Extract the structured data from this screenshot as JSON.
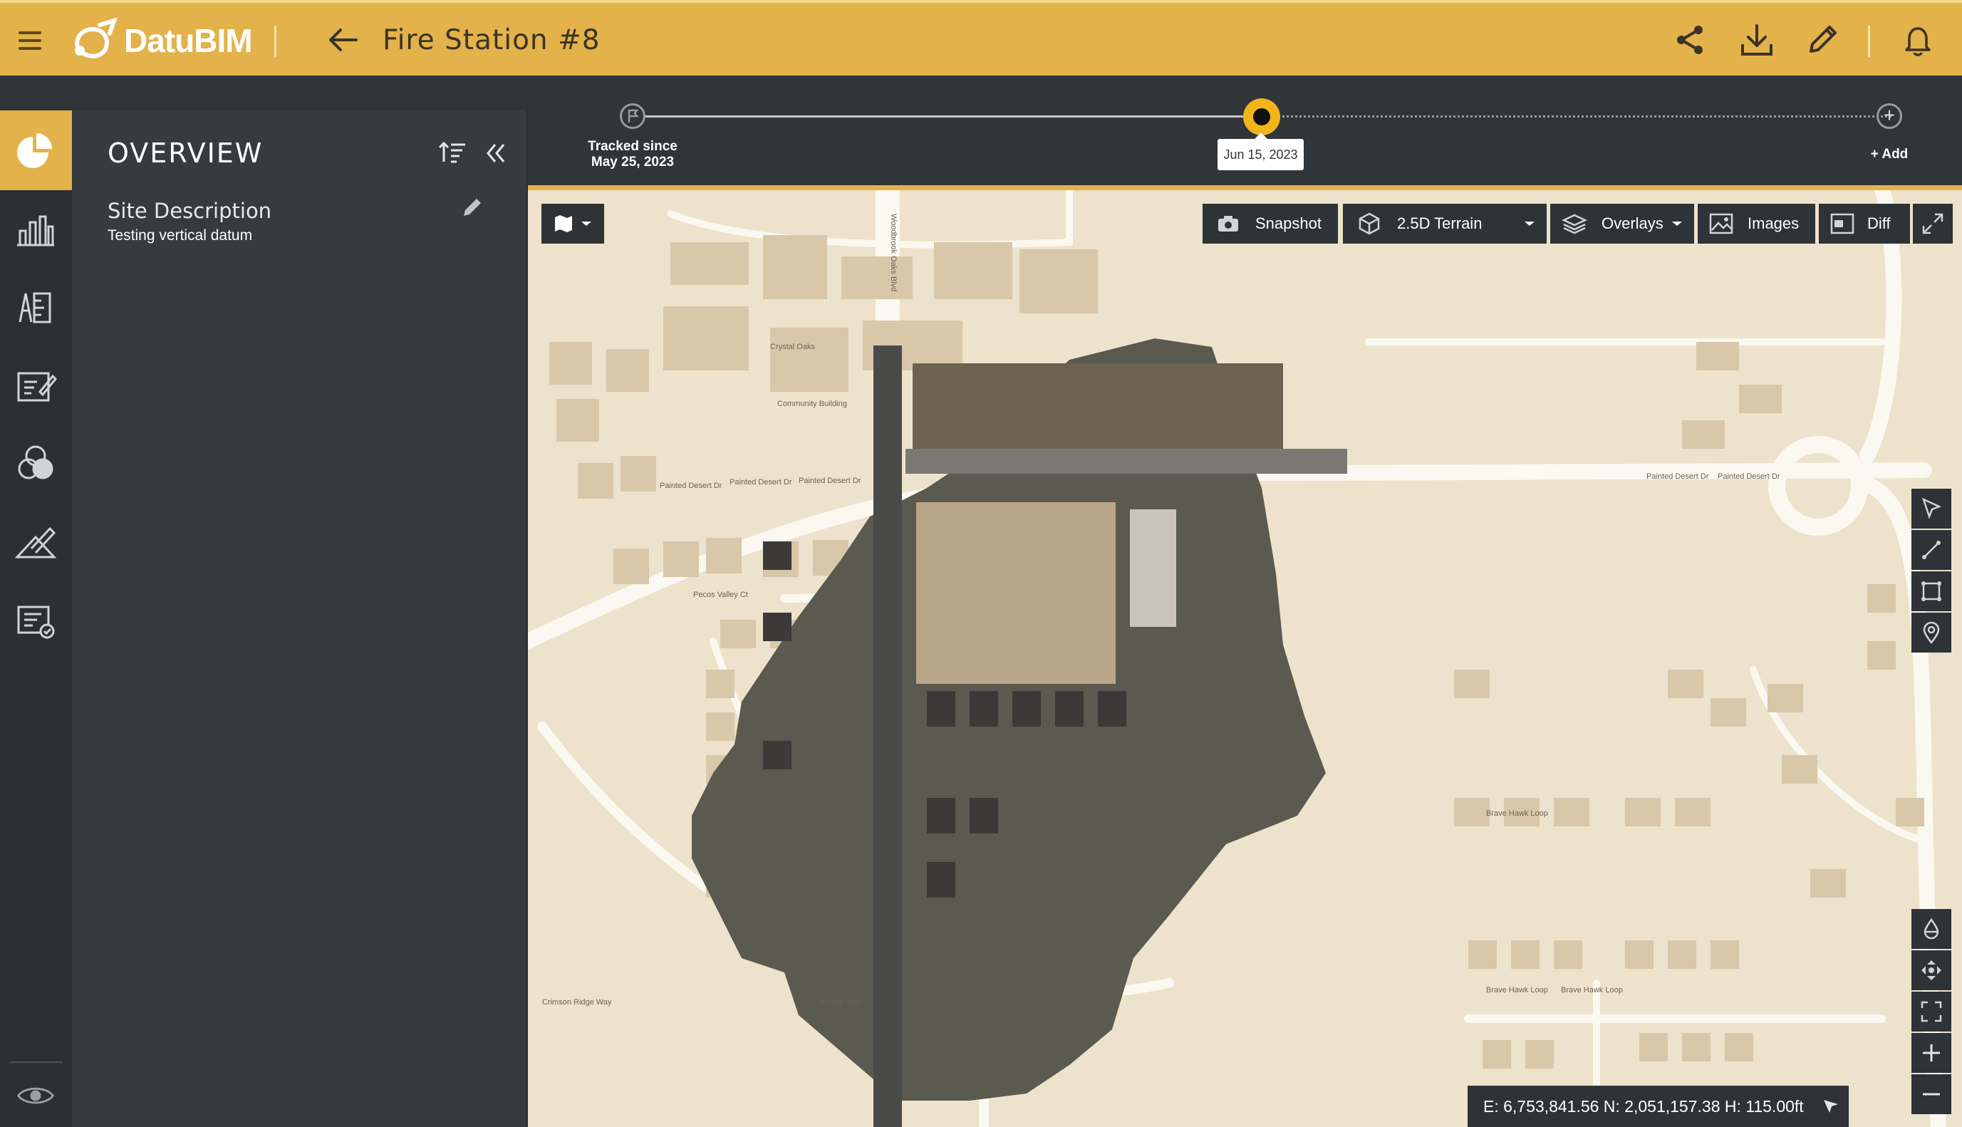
{
  "app": {
    "brand": "DatuBIM",
    "project_title": "Fire Station #8"
  },
  "topbar": {
    "icons": [
      "menu-icon",
      "back-arrow-icon",
      "share-icon",
      "download-icon",
      "edit-icon",
      "bell-icon"
    ]
  },
  "timeline": {
    "start_label_line1": "Tracked since",
    "start_label_line2": "May 25, 2023",
    "current_date": "Jun 15, 2023",
    "add_label": "+ Add"
  },
  "sidebar": {
    "items": [
      {
        "name": "overview",
        "icon": "pie-chart-icon",
        "active": true
      },
      {
        "name": "analytics",
        "icon": "bar-chart-icon"
      },
      {
        "name": "layers",
        "icon": "layers-book-icon"
      },
      {
        "name": "notes",
        "icon": "notes-icon"
      },
      {
        "name": "compare",
        "icon": "circles-icon"
      },
      {
        "name": "measure",
        "icon": "measure-icon"
      },
      {
        "name": "reports",
        "icon": "report-icon"
      }
    ],
    "bottom_icon": "eye-icon"
  },
  "panel": {
    "title": "OVERVIEW",
    "section_title": "Site Description",
    "section_subtitle": "Testing vertical datum"
  },
  "map_toolbar": {
    "snapshot": "Snapshot",
    "terrain": "2.5D Terrain",
    "overlays": "Overlays",
    "images": "Images",
    "diff": "Diff"
  },
  "map_labels": {
    "painted_desert_1": "Painted Desert Dr",
    "painted_desert_2": "Painted Desert Dr",
    "painted_desert_3": "Painted Desert Dr",
    "painted_desert_4": "Painted Desert Dr",
    "painted_desert_5": "Painted Desert Dr",
    "pecos_valley": "Pecos Valley Ct",
    "brave_hawk_1": "Brave Hawk Loop",
    "brave_hawk_2": "Brave Hawk Loop",
    "brave_hawk_3": "Brave Hawk Loop",
    "kodiak_way": "Kodiak Way",
    "crimson_ridge": "Crimson Ridge Way",
    "woodbrook": "Woodbrook Oaks Blvd",
    "community": "Community Building",
    "crystal_oaks": "Crystal Oaks"
  },
  "coords": {
    "text": "E: 6,753,841.56  N: 2,051,157.38  H: 115.00ft"
  },
  "colors": {
    "accent": "#e3b24a",
    "dark": "#2e3338",
    "panel": "#353b40",
    "map_bg": "#ede2cb"
  }
}
